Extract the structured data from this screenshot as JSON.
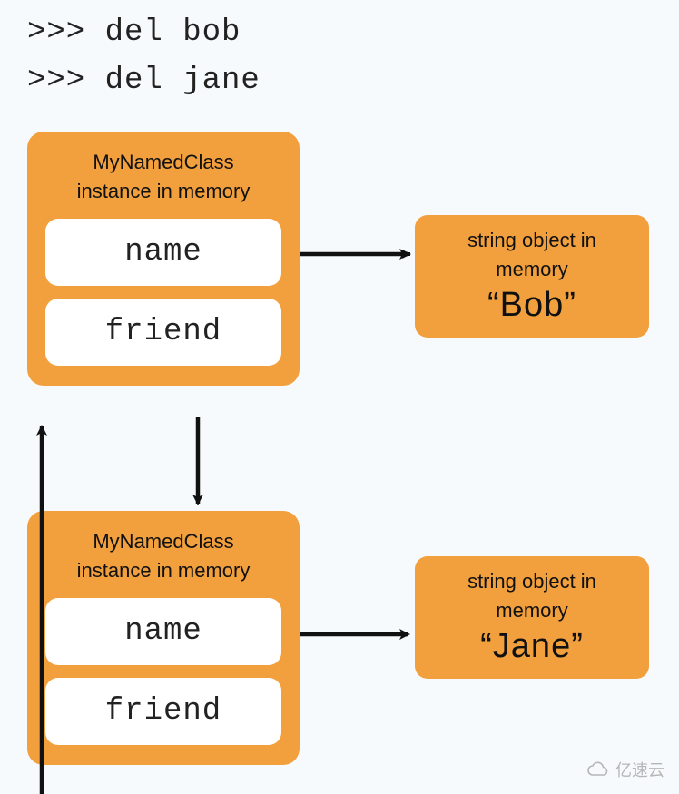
{
  "code": {
    "line1": ">>> del bob",
    "line2": ">>> del jane"
  },
  "instance1": {
    "title_line1": "MyNamedClass",
    "title_line2": "instance in memory",
    "attr1": "name",
    "attr2": "friend"
  },
  "instance2": {
    "title_line1": "MyNamedClass",
    "title_line2": "instance in memory",
    "attr1": "name",
    "attr2": "friend"
  },
  "string1": {
    "title_line1": "string object in",
    "title_line2": "memory",
    "value": "“Bob”"
  },
  "string2": {
    "title_line1": "string object in",
    "title_line2": "memory",
    "value": "“Jane”"
  },
  "watermark": "亿速云",
  "colors": {
    "box": "#f2a03d",
    "bg": "#f6fafc"
  }
}
